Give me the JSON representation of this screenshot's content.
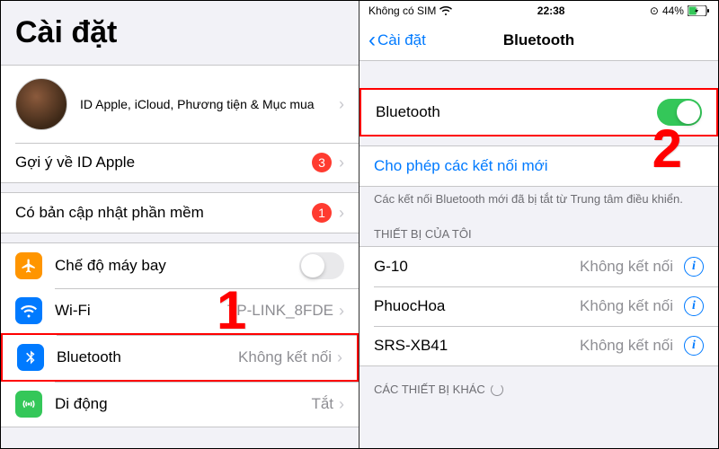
{
  "left": {
    "title": "Cài đặt",
    "profile_text": "ID Apple, iCloud, Phương tiện & Mục mua",
    "suggestion_label": "Gợi ý về ID Apple",
    "suggestion_badge": "3",
    "update_label": "Có bản cập nhật phần mềm",
    "update_badge": "1",
    "airplane_label": "Chế độ máy bay",
    "wifi_label": "Wi-Fi",
    "wifi_value": "TP-LINK_8FDE",
    "bluetooth_label": "Bluetooth",
    "bluetooth_value": "Không kết nối",
    "cellular_label": "Di động",
    "cellular_value": "Tắt",
    "annotation": "1"
  },
  "right": {
    "status_carrier": "Không có SIM",
    "status_time": "22:38",
    "status_battery": "44%",
    "nav_back": "Cài đặt",
    "nav_title": "Bluetooth",
    "toggle_label": "Bluetooth",
    "allow_new": "Cho phép các kết nối mới",
    "allow_note": "Các kết nối Bluetooth mới đã bị tắt từ Trung tâm điều khiển.",
    "my_devices_header": "THIẾT BỊ CỦA TÔI",
    "devices": [
      {
        "name": "G-10",
        "status": "Không kết nối"
      },
      {
        "name": "PhuocHoa",
        "status": "Không kết nối"
      },
      {
        "name": "SRS-XB41",
        "status": "Không kết nối"
      }
    ],
    "other_devices_header": "CÁC THIẾT BỊ KHÁC",
    "annotation": "2"
  }
}
